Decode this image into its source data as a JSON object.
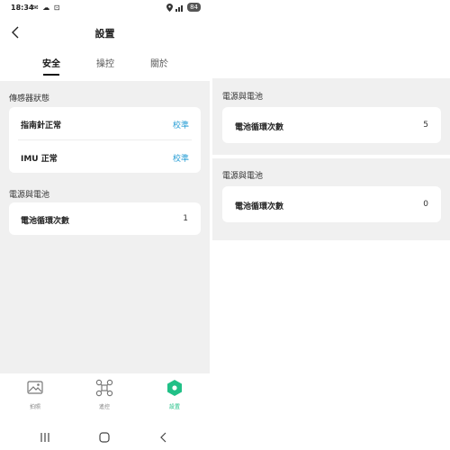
{
  "status": {
    "time": "18:34",
    "left_icons": "✉ ☁ ⊡",
    "battery": "84"
  },
  "header": {
    "title": "設置"
  },
  "tabs": [
    {
      "label": "安全"
    },
    {
      "label": "操控"
    },
    {
      "label": "關於"
    }
  ],
  "sensors": {
    "title": "傳感器狀態",
    "rows": [
      {
        "label": "指南針正常",
        "action": "校準"
      },
      {
        "label": "IMU 正常",
        "action": "校準"
      }
    ]
  },
  "power": {
    "title": "電源與電池",
    "cycles_label": "電池循環次數",
    "cycles_value": "1"
  },
  "bottom_nav": [
    {
      "label": "拍照",
      "icon": "image-icon"
    },
    {
      "label": "遙控",
      "icon": "drone-icon"
    },
    {
      "label": "設置",
      "icon": "settings-icon"
    }
  ],
  "right_panels": [
    {
      "title": "電源與電池",
      "label": "電池循環次數",
      "value": "5"
    },
    {
      "title": "電源與電池",
      "label": "電池循環次數",
      "value": "0"
    }
  ],
  "colors": {
    "accent_blue": "#2a9fd6",
    "accent_green": "#21c087",
    "bg_gray": "#f0f0f0"
  }
}
